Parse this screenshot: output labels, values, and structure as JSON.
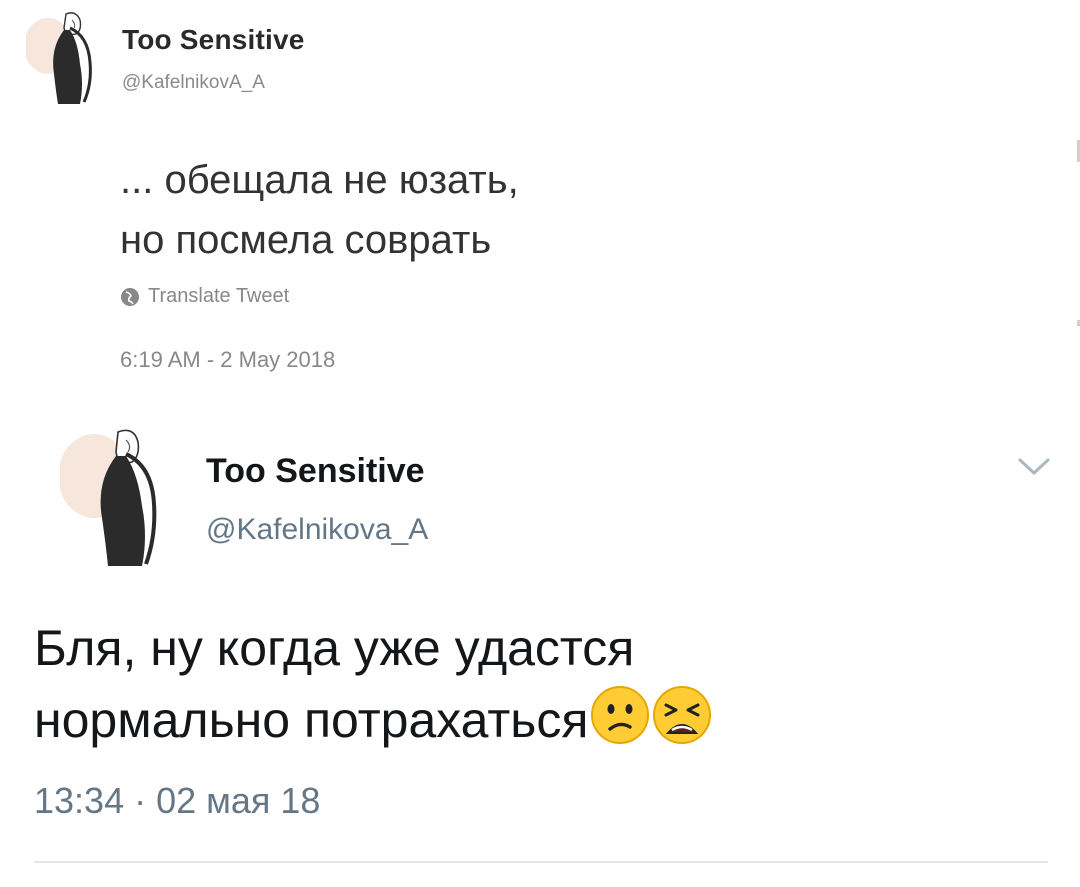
{
  "tweet_quoted": {
    "display_name": "Too Sensitive",
    "handle": "@KafelnikovA_A",
    "text_line1": "... обещала не юзать,",
    "text_line2": "но посмела соврать",
    "translate_label": "Translate Tweet",
    "translate_icon": "globe-icon",
    "timestamp": "6:19 AM - 2 May 2018"
  },
  "tweet_main": {
    "display_name": "Too Sensitive",
    "handle": "@Kafelnikova_A",
    "text_line1": "Бля, ну когда уже удастся",
    "text_line2": "нормально потрахаться",
    "emojis": [
      "confused-face",
      "weary-face"
    ],
    "timestamp": "13:34 · 02 мая 18",
    "menu_icon": "chevron-down-icon"
  },
  "colors": {
    "text_primary": "#14171a",
    "text_secondary": "#657786",
    "divider": "#e1e8ed",
    "emoji_yellow": "#ffcc33"
  }
}
